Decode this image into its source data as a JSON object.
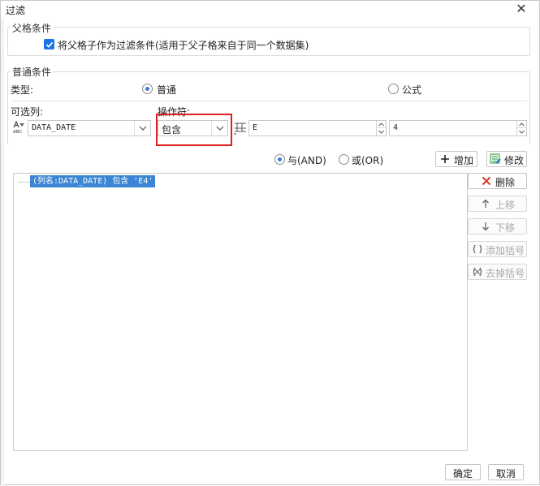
{
  "window": {
    "title": "过滤",
    "close_glyph": "✕"
  },
  "parent_condition": {
    "legend": "父格条件",
    "checkbox_label": "将父格子作为过滤条件(适用于父子格来自于同一个数据集)",
    "checked": true
  },
  "common_condition": {
    "legend": "普通条件",
    "type_label": "类型:",
    "radio_normal": "普通",
    "radio_formula": "公式",
    "selected_type": "普通",
    "column_label": "可选列:",
    "column_value": "DATA_DATE",
    "operator_label": "操作符:",
    "operator_value": "包含",
    "value_field": "E",
    "number_field": "4"
  },
  "logic": {
    "and_label": "与(AND)",
    "or_label": "或(OR)",
    "selected": "and"
  },
  "actions": {
    "add": "增加",
    "modify": "修改",
    "delete": "删除",
    "move_up": "上移",
    "move_down": "下移",
    "add_bracket": "添加括号",
    "remove_bracket": "去掉括号"
  },
  "conditions": [
    "(列名:DATA_DATE) 包含 'E4'"
  ],
  "footer": {
    "ok": "确定",
    "cancel": "取消"
  },
  "colors": {
    "accent": "#3a86d4",
    "highlight_box": "#e02020",
    "delete_red": "#d83a2b",
    "modify_green": "#2f9e44"
  }
}
